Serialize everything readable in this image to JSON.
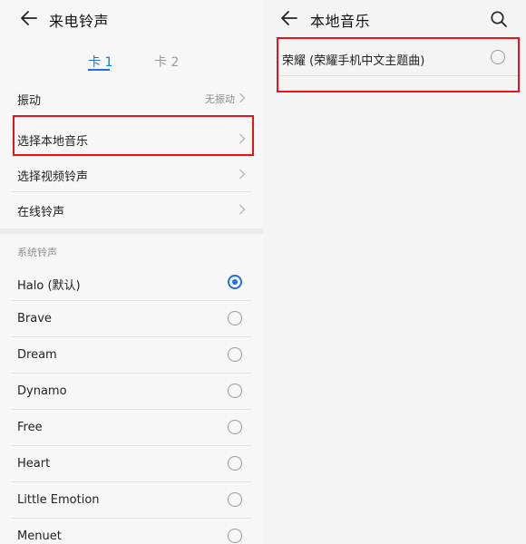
{
  "left": {
    "title": "来电铃声",
    "tabs": [
      {
        "label": "卡 1",
        "active": true
      },
      {
        "label": "卡 2",
        "active": false
      }
    ],
    "vibration": {
      "label": "振动",
      "value": "无振动"
    },
    "items": [
      {
        "label": "选择本地音乐"
      },
      {
        "label": "选择视频铃声"
      },
      {
        "label": "在线铃声"
      }
    ],
    "system_section_label": "系统铃声",
    "ringtones": [
      {
        "label": "Halo (默认)",
        "selected": true
      },
      {
        "label": "Brave",
        "selected": false
      },
      {
        "label": "Dream",
        "selected": false
      },
      {
        "label": "Dynamo",
        "selected": false
      },
      {
        "label": "Free",
        "selected": false
      },
      {
        "label": "Heart",
        "selected": false
      },
      {
        "label": "Little Emotion",
        "selected": false
      },
      {
        "label": "Menuet",
        "selected": false
      }
    ]
  },
  "right": {
    "title": "本地音乐",
    "songs": [
      {
        "label": "荣耀 (荣耀手机中文主题曲)",
        "selected": false
      }
    ]
  },
  "colors": {
    "accent": "#1f6fe5",
    "highlight_box": "#e8141a"
  }
}
